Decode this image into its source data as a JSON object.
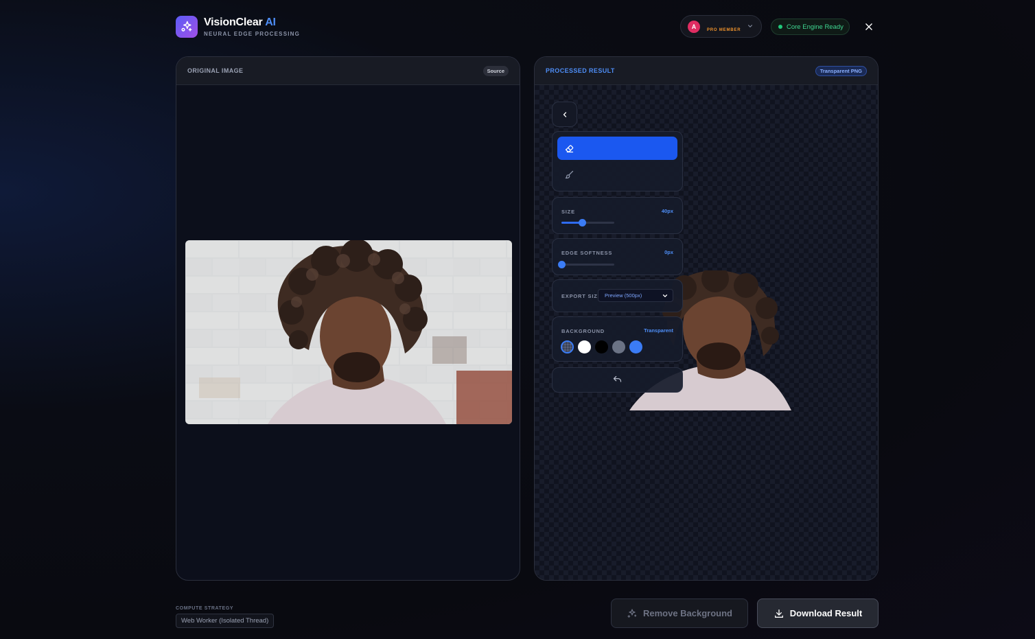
{
  "brand": {
    "name": "VisionClear",
    "accent": "AI",
    "subtitle": "NEURAL EDGE PROCESSING"
  },
  "header": {
    "avatar_initial": "A",
    "member_label": "PRO MEMBER",
    "engine_status": "Core Engine Ready"
  },
  "left_panel": {
    "title": "ORIGINAL IMAGE",
    "badge": "Source"
  },
  "right_panel": {
    "title": "PROCESSED RESULT",
    "badge": "Transparent PNG"
  },
  "tools": {
    "active_mode": "erase",
    "size": {
      "label": "SIZE",
      "value": "40px",
      "fraction": 0.39
    },
    "edge_softness": {
      "label": "EDGE SOFTNESS",
      "value": "0px",
      "fraction": 0.0
    },
    "export_size": {
      "label": "EXPORT SIZE",
      "selected": "Preview (500px)"
    },
    "background": {
      "label": "BACKGROUND",
      "selected": "Transparent",
      "swatches": [
        "transparent",
        "#ffffff",
        "#000000",
        "#6b7385",
        "#3b7cf5"
      ]
    }
  },
  "footer": {
    "compute_label": "COMPUTE STRATEGY",
    "compute_value": "Web Worker (Isolated Thread)",
    "remove_label": "Remove Background",
    "download_label": "Download Result"
  },
  "colors": {
    "accent": "#4e8ef7",
    "primary_button": "#1b58f0",
    "engine_ready": "#21c77a",
    "pro": "#f2942c"
  }
}
